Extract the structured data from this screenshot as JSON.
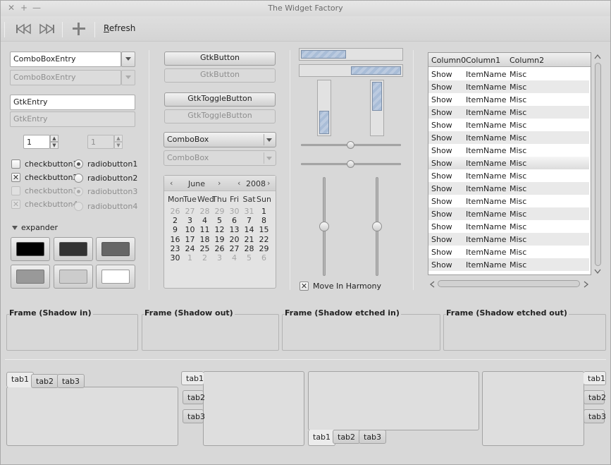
{
  "window": {
    "title": "The Widget Factory",
    "controls": [
      "✕",
      "+",
      "—"
    ]
  },
  "toolbar": {
    "refresh_label": "efresh",
    "refresh_mnemonic": "R"
  },
  "combos": {
    "entry1": "ComboBoxEntry",
    "entry2": "ComboBoxEntry",
    "combo1": "ComboBox",
    "combo2": "ComboBox"
  },
  "entries": {
    "entry1": "GtkEntry",
    "entry2": "GtkEntry"
  },
  "spins": {
    "spin1": "1",
    "spin2": "1"
  },
  "buttons": {
    "button1": "GtkButton",
    "button2": "GtkButton",
    "toggle1": "GtkToggleButton",
    "toggle2": "GtkToggleButton"
  },
  "checks": [
    {
      "label": "checkbutton1",
      "checked": false,
      "enabled": true
    },
    {
      "label": "checkbutton2",
      "checked": true,
      "enabled": true
    },
    {
      "label": "checkbutton3",
      "checked": false,
      "enabled": false
    },
    {
      "label": "checkbutton4",
      "checked": true,
      "enabled": false
    }
  ],
  "radios": [
    {
      "label": "radiobutton1",
      "selected": true,
      "enabled": true
    },
    {
      "label": "radiobutton2",
      "selected": false,
      "enabled": true
    },
    {
      "label": "radiobutton3",
      "selected": true,
      "enabled": false
    },
    {
      "label": "radiobutton4",
      "selected": false,
      "enabled": false
    }
  ],
  "expander": {
    "label": "expander"
  },
  "swatches": [
    "#000000",
    "#333333",
    "#666666",
    "#999999",
    "#cccccc",
    "#ffffff"
  ],
  "calendar": {
    "month": "June",
    "year": "2008",
    "weekdays": [
      "Mon",
      "Tue",
      "Wed",
      "Thu",
      "Fri",
      "Sat",
      "Sun"
    ],
    "prev_days": [
      "26",
      "27",
      "28",
      "29",
      "30",
      "31"
    ],
    "days": [
      "1",
      "2",
      "3",
      "4",
      "5",
      "6",
      "7",
      "8",
      "9",
      "10",
      "11",
      "12",
      "13",
      "14",
      "15",
      "16",
      "17",
      "18",
      "19",
      "20",
      "21",
      "22",
      "23",
      "24",
      "25",
      "26",
      "27",
      "28",
      "29",
      "30"
    ],
    "next_days": [
      "1",
      "2",
      "3",
      "4",
      "5",
      "6"
    ]
  },
  "progress": {
    "horizontal1": 0.45,
    "horizontal2": 0.5,
    "vertical1": 0.45,
    "vertical2": 0.55
  },
  "move_in_harmony": {
    "label": "Move In Harmony",
    "checked": true
  },
  "tree": {
    "columns": [
      "Column0",
      "Column1",
      "Column2"
    ],
    "rows": [
      [
        "Show",
        "ItemName",
        "Misc"
      ],
      [
        "Show",
        "ItemName",
        "Misc"
      ],
      [
        "Show",
        "ItemName",
        "Misc"
      ],
      [
        "Show",
        "ItemName",
        "Misc"
      ],
      [
        "Show",
        "ItemName",
        "Misc"
      ],
      [
        "Show",
        "ItemName",
        "Misc"
      ],
      [
        "Show",
        "ItemName",
        "Misc"
      ],
      [
        "Show",
        "ItemName",
        "Misc"
      ],
      [
        "Show",
        "ItemName",
        "Misc"
      ],
      [
        "Show",
        "ItemName",
        "Misc"
      ],
      [
        "Show",
        "ItemName",
        "Misc"
      ],
      [
        "Show",
        "ItemName",
        "Misc"
      ],
      [
        "Show",
        "ItemName",
        "Misc"
      ],
      [
        "Show",
        "ItemName",
        "Misc"
      ],
      [
        "Show",
        "ItemName",
        "Misc"
      ],
      [
        "Show",
        "ItemName",
        "Misc"
      ]
    ],
    "selected_row": 7
  },
  "frames": [
    "Frame (Shadow in)",
    "Frame (Shadow out)",
    "Frame (Shadow etched in)",
    "Frame (Shadow etched out)"
  ],
  "notebooks": {
    "top": [
      "tab1",
      "tab2",
      "tab3"
    ],
    "left": [
      "tab1",
      "tab2",
      "tab3"
    ],
    "bottom": [
      "tab1",
      "tab2",
      "tab3"
    ],
    "right": [
      "tab1",
      "tab2",
      "tab3"
    ]
  }
}
